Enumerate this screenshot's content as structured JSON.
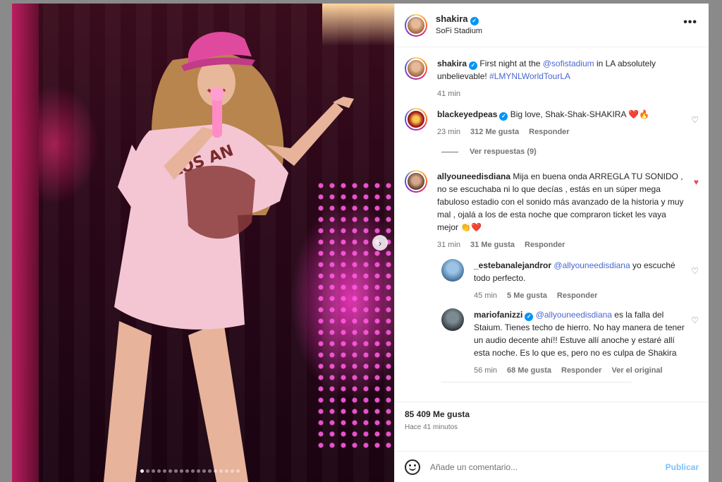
{
  "post": {
    "author": "shakira",
    "location": "SoFi Stadium",
    "more_icon": "more-horizontal-icon",
    "caption": {
      "author": "shakira",
      "text_before": "First night at the ",
      "mention": "@sofistadium",
      "text_after": " in LA absolutely unbelievable! ",
      "hashtag": "#LMYNLWorldTourLA",
      "time": "41 min"
    }
  },
  "comments": [
    {
      "user": "blackeyedpeas",
      "text": "Big love, Shak-Shak-SHAKIRA ❤️🔥",
      "time": "23 min",
      "likes": "312 Me gusta",
      "reply": "Responder",
      "view_replies": "Ver respuestas (9)"
    },
    {
      "user": "allyouneedisdiana",
      "text": "Mija en buena onda ARREGLA TU SONIDO , no se escuchaba ni lo que decías , estás en un súper mega fabuloso estadio con el sonido más avanzado de la historia y muy mal , ojalá a los de esta noche que compraron ticket les vaya mejor 👏❤️",
      "time": "31 min",
      "likes": "31 Me gusta",
      "reply": "Responder"
    }
  ],
  "replies": [
    {
      "user": "_estebanalejandror",
      "mention": "@allyouneedisdiana",
      "text": " yo escuché todo perfecto.",
      "time": "45 min",
      "likes": "5 Me gusta",
      "reply": "Responder"
    },
    {
      "user": "mariofanizzi",
      "mention": "@allyouneedisdiana",
      "text": " es la falla del Staium. Tienes techo de hierro. No hay manera de tener un audio decente ahí!! Estuve allí anoche y estaré allí esta noche. Es lo que es, pero no es culpa de Shakira",
      "time": "56 min",
      "likes": "68 Me gusta",
      "reply": "Responder",
      "original": "Ver el original"
    }
  ],
  "footer": {
    "likes": "85 409 Me gusta",
    "ago": "Hace 41 minutos"
  },
  "composer": {
    "placeholder": "Añade un comentario...",
    "publish": "Publicar"
  },
  "carousel": {
    "next_icon": "chevron-right-icon",
    "active_index": 0,
    "count": 18
  }
}
